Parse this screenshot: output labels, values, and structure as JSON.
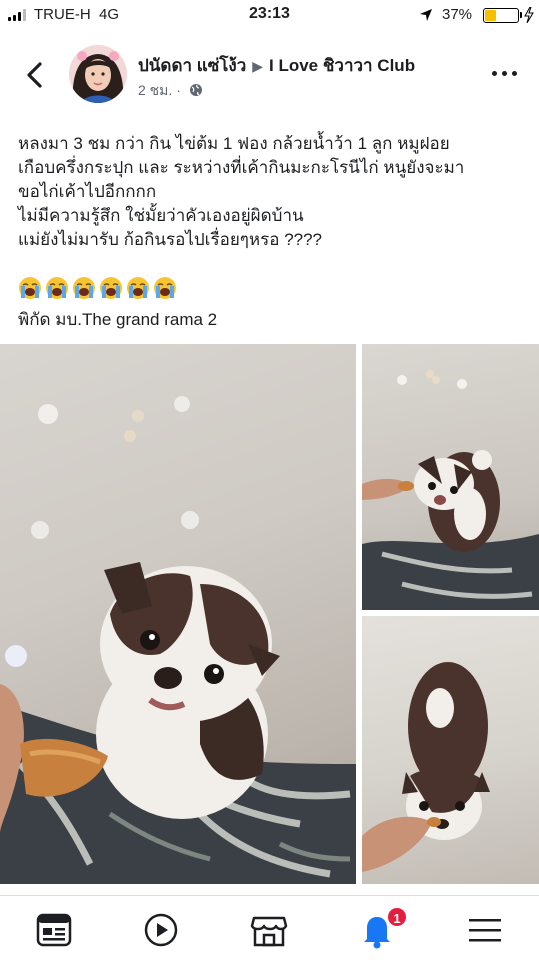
{
  "status_bar": {
    "carrier": "TRUE-H",
    "network": "4G",
    "time": "23:13",
    "battery_percent_label": "37%",
    "battery_level": 0.37
  },
  "post": {
    "author": "ปนัดดา แซ่โง้ว",
    "group": "I Love ชิวาวา Club",
    "time_ago": "2 ชม.",
    "separator": "·",
    "text_lines": [
      "หลงมา 3 ชม กว่า กิน ไข่ต้ม 1 ฟอง กล้วยน้ำว้า 1 ลูก หมูฝอย",
      "เกือบครึ่งกระปุก และ ระหว่างที่เค้ากินมะกะโรนีไก่ หนูยังจะมา",
      "ขอไก่เค้าไปอีกกกก",
      "ไม่มีความรู้สึก ใช่มั้ยว่าคัวเองอยู่ผิดบ้าน",
      "แม่ยังไม่มารับ ก้อกินรอไปเรื่อยๆหรอ ????"
    ],
    "emoji_count": 6,
    "emoji_icon": "loudly-crying-face-icon",
    "location_line": "พิกัด มบ.The grand rama 2"
  },
  "bottom_nav": {
    "items": [
      "news-feed-icon",
      "watch-icon",
      "marketplace-icon",
      "notifications-icon",
      "menu-icon"
    ],
    "notification_badge": "1",
    "active_color": "#1877f2",
    "badge_color": "#e41e3f"
  }
}
